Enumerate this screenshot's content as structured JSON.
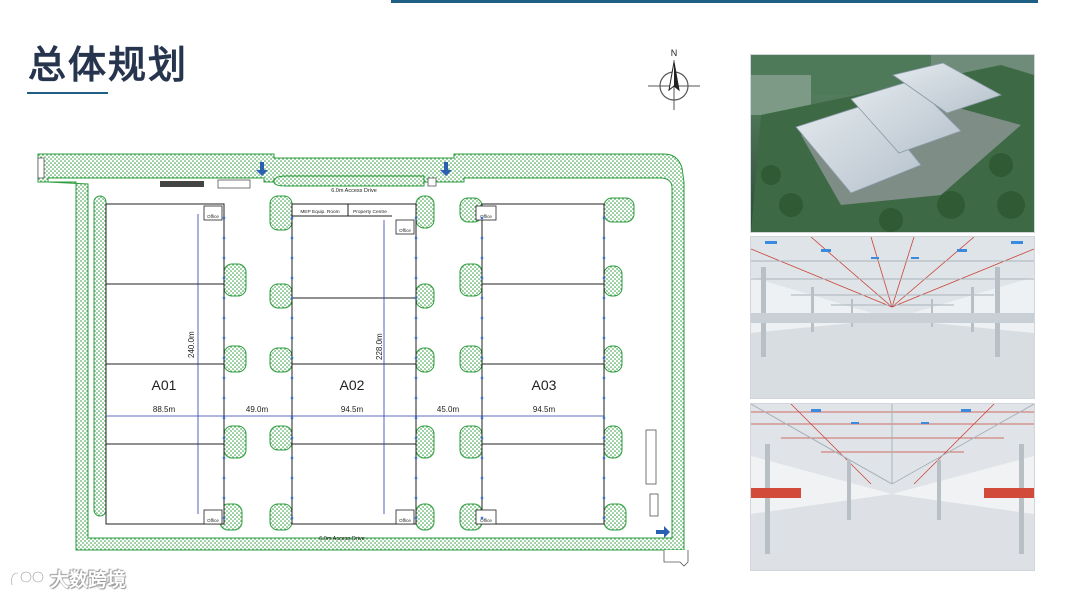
{
  "slide": {
    "title": "总体规划",
    "watermark": "大数跨境"
  },
  "compass": {
    "north_label": "N"
  },
  "site_plan": {
    "access_drive_top": "6.0m Access Drive",
    "access_drive_bottom": "6.0m Access Drive",
    "buildings": [
      {
        "id": "A01",
        "width_label": "88.5m",
        "length_label": "240.0m"
      },
      {
        "id": "A02",
        "width_label": "94.5m",
        "length_label": "228.0m"
      },
      {
        "id": "A03",
        "width_label": "94.5m"
      }
    ],
    "gaps": [
      "49.0m",
      "45.0m"
    ],
    "office_label": "Office",
    "rooms": [
      "MEP Equip. Room",
      "Property Centre"
    ]
  },
  "photos": [
    {
      "name": "aerial-rendering"
    },
    {
      "name": "warehouse-interior-1"
    },
    {
      "name": "warehouse-interior-2"
    }
  ],
  "colors": {
    "accent": "#1f5f86",
    "title": "#26354d",
    "landscape_green": "#2f9e3f",
    "plan_line": "#2b3bb0"
  }
}
